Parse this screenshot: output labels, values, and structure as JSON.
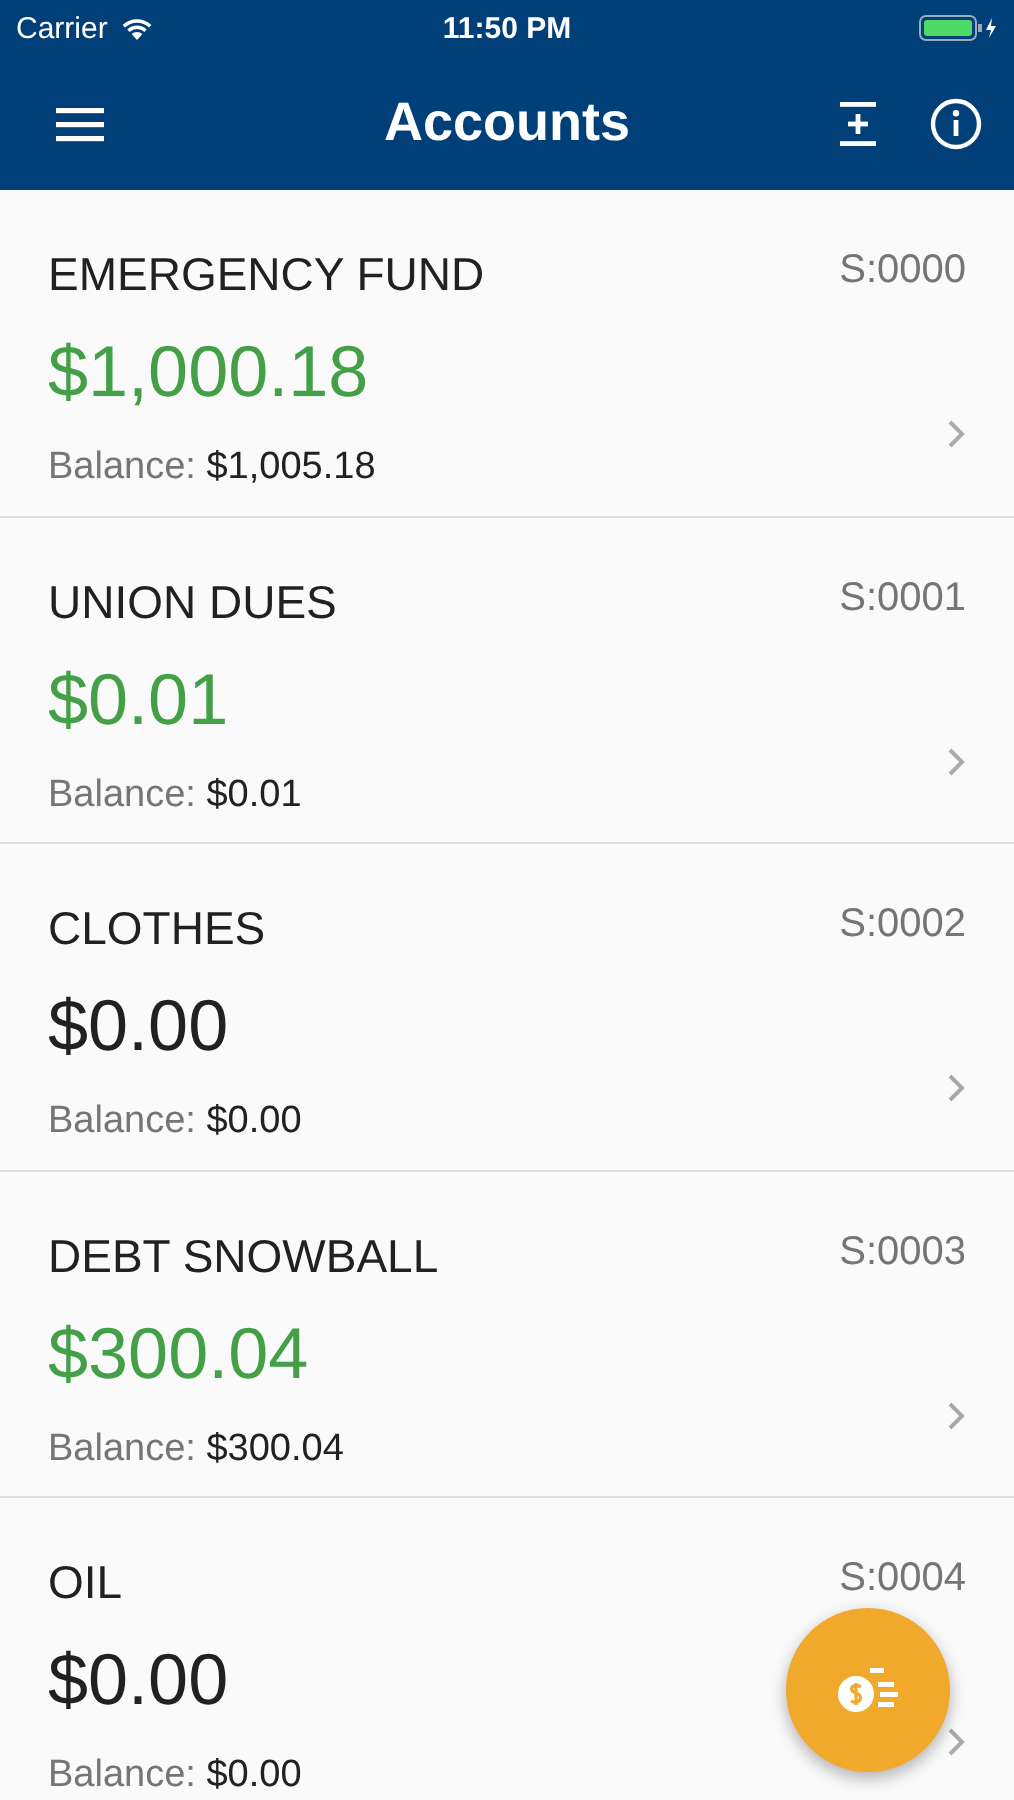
{
  "status_bar": {
    "carrier": "Carrier",
    "time": "11:50 PM"
  },
  "nav": {
    "title": "Accounts"
  },
  "accounts": [
    {
      "name": "EMERGENCY FUND",
      "code": "S:0000",
      "amount": "$1,000.18",
      "color": "#43a047",
      "balance_label": "Balance:",
      "balance": "$1,005.18"
    },
    {
      "name": "UNION DUES",
      "code": "S:0001",
      "amount": "$0.01",
      "color": "#43a047",
      "balance_label": "Balance:",
      "balance": "$0.01"
    },
    {
      "name": "CLOTHES",
      "code": "S:0002",
      "amount": "$0.00",
      "color": "#212121",
      "balance_label": "Balance:",
      "balance": "$0.00"
    },
    {
      "name": "DEBT SNOWBALL",
      "code": "S:0003",
      "amount": "$300.04",
      "color": "#43a047",
      "balance_label": "Balance:",
      "balance": "$300.04"
    },
    {
      "name": "OIL",
      "code": "S:0004",
      "amount": "$0.00",
      "color": "#212121",
      "balance_label": "Balance:",
      "balance": "$0.00"
    }
  ]
}
